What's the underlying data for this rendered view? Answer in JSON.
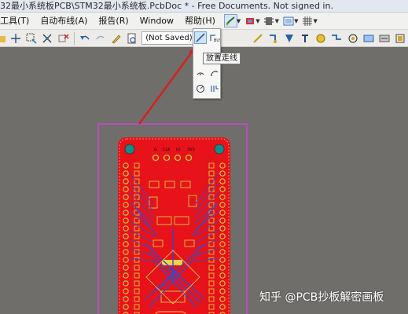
{
  "window": {
    "title": "32最小系统板PCB\\STM32最小系统板.PcbDoc * - Free Documents. Not signed in."
  },
  "menu": {
    "items": [
      "工具(T)",
      "自动布线(A)",
      "报告(R)",
      "Window",
      "帮助(H)"
    ]
  },
  "toolbar": {
    "status_text": "(Not Saved)"
  },
  "dropdown": {
    "tooltip": "放置走线",
    "cells": [
      "place-track-icon",
      "interactive-routing-icon",
      "arc-center-icon",
      "arc-edge-icon",
      "arc-any-angle-icon",
      "full-circle-icon",
      "diff-pair-icon"
    ]
  },
  "colors": {
    "board": "#e8121a",
    "board_outline": "#d641d4",
    "silkscreen": "#f2d64a",
    "bottom_trace": "#3a47c8",
    "pad": "#d9cc3f",
    "mount_hole": "#1a8a86",
    "canvas": "#6f6e6b",
    "arrow": "#d62020"
  },
  "board": {
    "top_labels": [
      "G",
      "CLK",
      "IO",
      "3V3"
    ]
  },
  "watermark": {
    "text": "知乎 @PCB抄板解密画板"
  }
}
